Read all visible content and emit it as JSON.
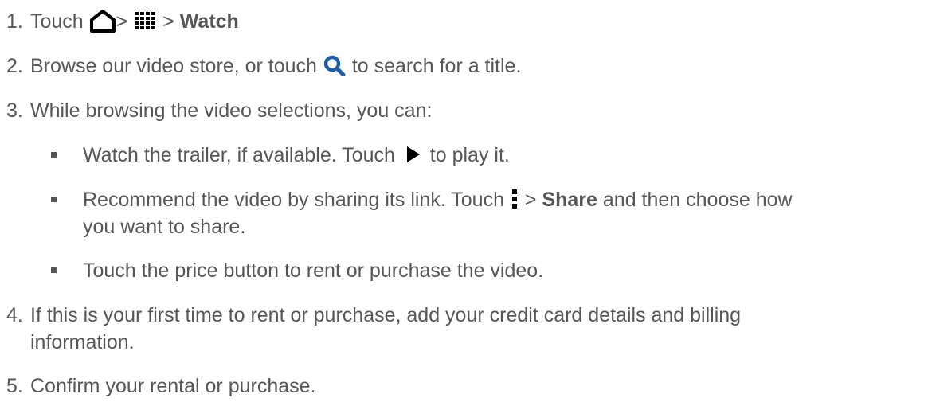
{
  "steps": [
    {
      "number": "1.",
      "parts": {
        "a": "Touch",
        "sep1": ">",
        "sep2": ">",
        "bold": "Watch"
      }
    },
    {
      "number": "2.",
      "parts": {
        "a": "Browse our video store, or touch",
        "b": "to search for a title."
      }
    },
    {
      "number": "3.",
      "text": "While browsing the video selections, you can:",
      "bullets": [
        {
          "a": "Watch the trailer, if available. Touch",
          "b": "to play it."
        },
        {
          "a": "Recommend the video by sharing its link. Touch",
          "sep": ">",
          "bold": "Share",
          "b": "and then choose how",
          "c": "you want to share."
        },
        {
          "a": "Touch the price button to rent or purchase the video."
        }
      ]
    },
    {
      "number": "4.",
      "line1": "If this is your first time to rent or purchase, add your credit card details and billing",
      "line2": "information."
    },
    {
      "number": "5.",
      "text": "Confirm your rental or purchase."
    }
  ],
  "icons": {
    "home": "home-icon",
    "apps": "apps-grid-icon",
    "search": "search-icon",
    "play": "play-icon",
    "menu": "more-options-icon"
  }
}
